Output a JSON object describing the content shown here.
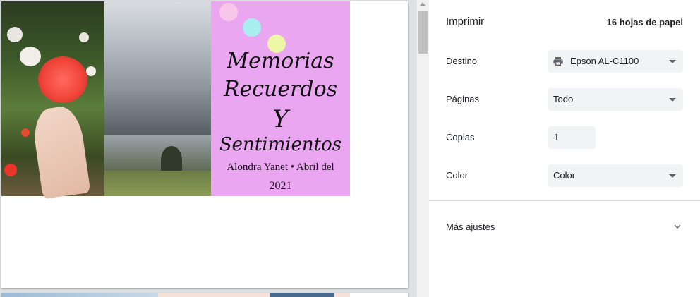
{
  "preview": {
    "cover": {
      "line1": "Memorias",
      "line2": "Recuerdos",
      "line3": "Y",
      "line4": "Sentimientos",
      "author_line1": "Alondra Yanet • Abril del",
      "author_line2": "2021"
    },
    "colors": {
      "cover_bg": "#eba6f2",
      "dot_pink": "#f7c6e9",
      "dot_cyan": "#a9eef0",
      "dot_yellow": "#edf7a6"
    }
  },
  "panel": {
    "title": "Imprimir",
    "sheet_count": "16 hojas de papel",
    "rows": {
      "destination_label": "Destino",
      "destination_value": "Epson AL-C1100",
      "destination_icon": "printer-icon",
      "pages_label": "Páginas",
      "pages_value": "Todo",
      "copies_label": "Copias",
      "copies_value": "1",
      "color_label": "Color",
      "color_value": "Color"
    },
    "more_settings": "Más ajustes",
    "more_icon": "chevron-down-icon"
  }
}
